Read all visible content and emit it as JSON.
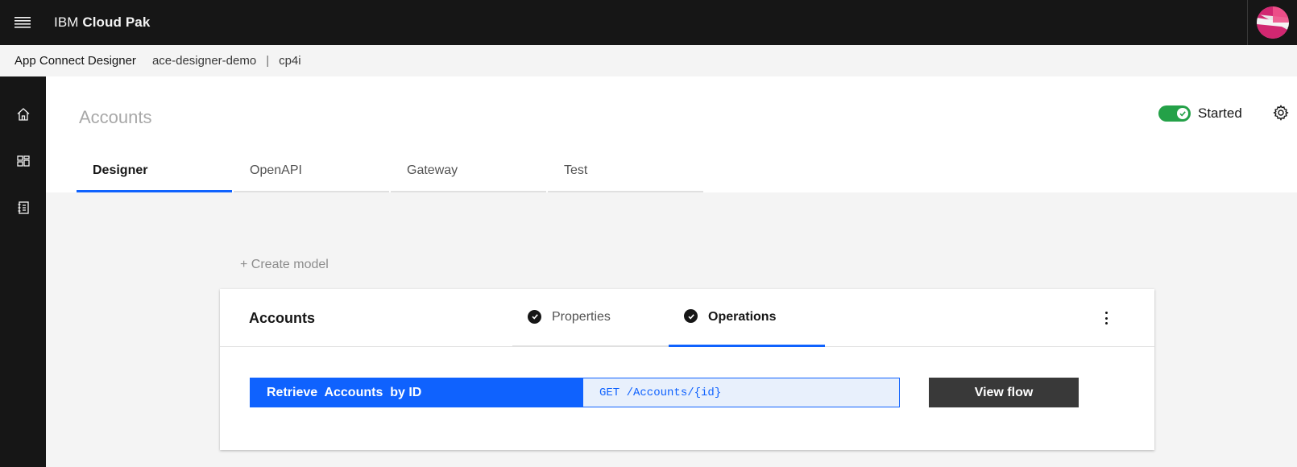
{
  "header": {
    "brand_prefix": "IBM",
    "brand_name": "Cloud Pak",
    "menu_icon": "hamburger-menu-icon",
    "avatar_icon": "user-avatar"
  },
  "breadcrumb": {
    "app": "App Connect Designer",
    "instance": "ace-designer-demo",
    "separator": "|",
    "namespace": "cp4i"
  },
  "sidenav": {
    "items": [
      {
        "icon": "home-icon"
      },
      {
        "icon": "dashboard-icon"
      },
      {
        "icon": "catalog-icon"
      }
    ]
  },
  "page": {
    "title": "Accounts",
    "status": "Started",
    "status_on": true,
    "settings_icon": "gear-icon"
  },
  "tabs": [
    {
      "label": "Designer",
      "active": true
    },
    {
      "label": "OpenAPI",
      "active": false
    },
    {
      "label": "Gateway",
      "active": false
    },
    {
      "label": "Test",
      "active": false
    }
  ],
  "main": {
    "create_model": "+ Create model",
    "card": {
      "title": "Accounts",
      "tabs": [
        {
          "label": "Properties",
          "checked": true,
          "active": false
        },
        {
          "label": "Operations",
          "checked": true,
          "active": true
        }
      ],
      "operation": {
        "name": "Retrieve  Accounts  by ID",
        "path": "GET /Accounts/{id}"
      },
      "view_flow": "View flow"
    }
  },
  "colors": {
    "accent": "#0f62fe",
    "status_green": "#24a148",
    "header_bg": "#161616"
  }
}
